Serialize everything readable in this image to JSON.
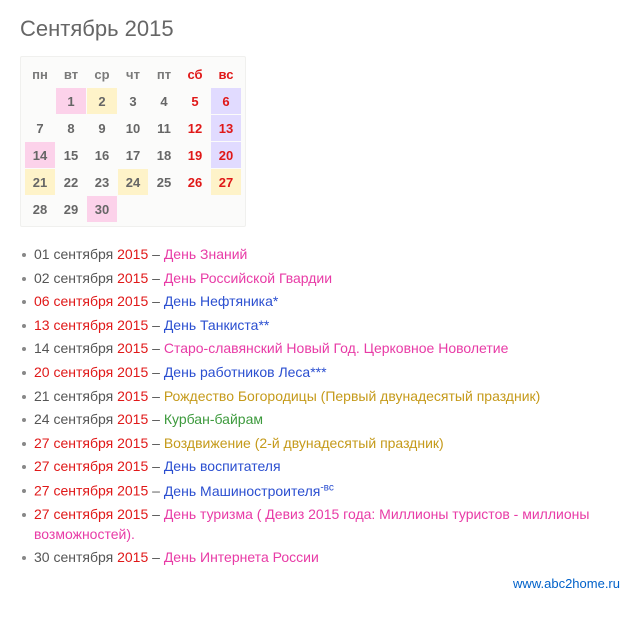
{
  "title": "Сентябрь 2015",
  "weekdays": [
    "пн",
    "вт",
    "ср",
    "чт",
    "пт",
    "сб",
    "вс"
  ],
  "weeks": [
    [
      {
        "v": ""
      },
      {
        "v": "1",
        "cls": "hl-pink"
      },
      {
        "v": "2",
        "cls": "hl-yel"
      },
      {
        "v": "3"
      },
      {
        "v": "4"
      },
      {
        "v": "5",
        "cls": "we"
      },
      {
        "v": "6",
        "cls": "we hl-pur"
      }
    ],
    [
      {
        "v": "7"
      },
      {
        "v": "8"
      },
      {
        "v": "9"
      },
      {
        "v": "10"
      },
      {
        "v": "11"
      },
      {
        "v": "12",
        "cls": "we"
      },
      {
        "v": "13",
        "cls": "we hl-pur"
      }
    ],
    [
      {
        "v": "14",
        "cls": "hl-pink"
      },
      {
        "v": "15"
      },
      {
        "v": "16"
      },
      {
        "v": "17"
      },
      {
        "v": "18"
      },
      {
        "v": "19",
        "cls": "we"
      },
      {
        "v": "20",
        "cls": "we hl-pur"
      }
    ],
    [
      {
        "v": "21",
        "cls": "hl-yel"
      },
      {
        "v": "22"
      },
      {
        "v": "23"
      },
      {
        "v": "24",
        "cls": "hl-yel"
      },
      {
        "v": "25"
      },
      {
        "v": "26",
        "cls": "we"
      },
      {
        "v": "27",
        "cls": "we hl-yel"
      }
    ],
    [
      {
        "v": "28"
      },
      {
        "v": "29"
      },
      {
        "v": "30",
        "cls": "hl-pink"
      },
      {
        "v": ""
      },
      {
        "v": ""
      },
      {
        "v": ""
      },
      {
        "v": ""
      }
    ]
  ],
  "events": [
    {
      "day": "01 сентября",
      "dayCls": "d-dark",
      "year": "2015",
      "name": "День Знаний",
      "nameCls": "n-pink"
    },
    {
      "day": "02 сентября",
      "dayCls": "d-dark",
      "year": "2015",
      "name": "День Российской Гвардии",
      "nameCls": "n-pink"
    },
    {
      "day": "06 сентября",
      "dayCls": "d-red",
      "year": "2015",
      "name": "День Нефтяника*",
      "nameCls": "n-blue"
    },
    {
      "day": "13 сентября",
      "dayCls": "d-red",
      "year": "2015",
      "name": "День Танкиста**",
      "nameCls": "n-blue"
    },
    {
      "day": "14 сентября",
      "dayCls": "d-dark",
      "year": "2015",
      "name": "Старо-славянский Новый Год. Церковное Новолетие",
      "nameCls": "n-pink"
    },
    {
      "day": "20 сентября",
      "dayCls": "d-red",
      "year": "2015",
      "name": "День работников Леса***",
      "nameCls": "n-blue"
    },
    {
      "day": "21 сентября",
      "dayCls": "d-dark",
      "year": "2015",
      "name": "Рождество Богородицы (Первый двунадесятый праздник)",
      "nameCls": "n-gold"
    },
    {
      "day": "24 сентября",
      "dayCls": "d-dark",
      "year": "2015",
      "name": "Курбан-байрам",
      "nameCls": "n-green"
    },
    {
      "day": "27 сентября",
      "dayCls": "d-red",
      "year": "2015",
      "name": "Воздвижение (2-й двунадесятый праздник)",
      "nameCls": "n-gold"
    },
    {
      "day": "27 сентября",
      "dayCls": "d-red",
      "year": "2015",
      "name": "День воспитателя",
      "nameCls": "n-blue"
    },
    {
      "day": "27 сентября",
      "dayCls": "d-red",
      "year": "2015",
      "name": "День Машиностроителя",
      "nameCls": "n-blue",
      "sup": "-вс"
    },
    {
      "day": "27 сентября",
      "dayCls": "d-red",
      "year": "2015",
      "name": "День туризма ( Девиз 2015 года: Миллионы туристов - миллионы возможностей).",
      "nameCls": "n-pink"
    },
    {
      "day": "30 сентября",
      "dayCls": "d-dark",
      "year": "2015",
      "name": "День Интернета России",
      "nameCls": "n-pink"
    }
  ],
  "dash": " – ",
  "footer": "www.abc2home.ru"
}
